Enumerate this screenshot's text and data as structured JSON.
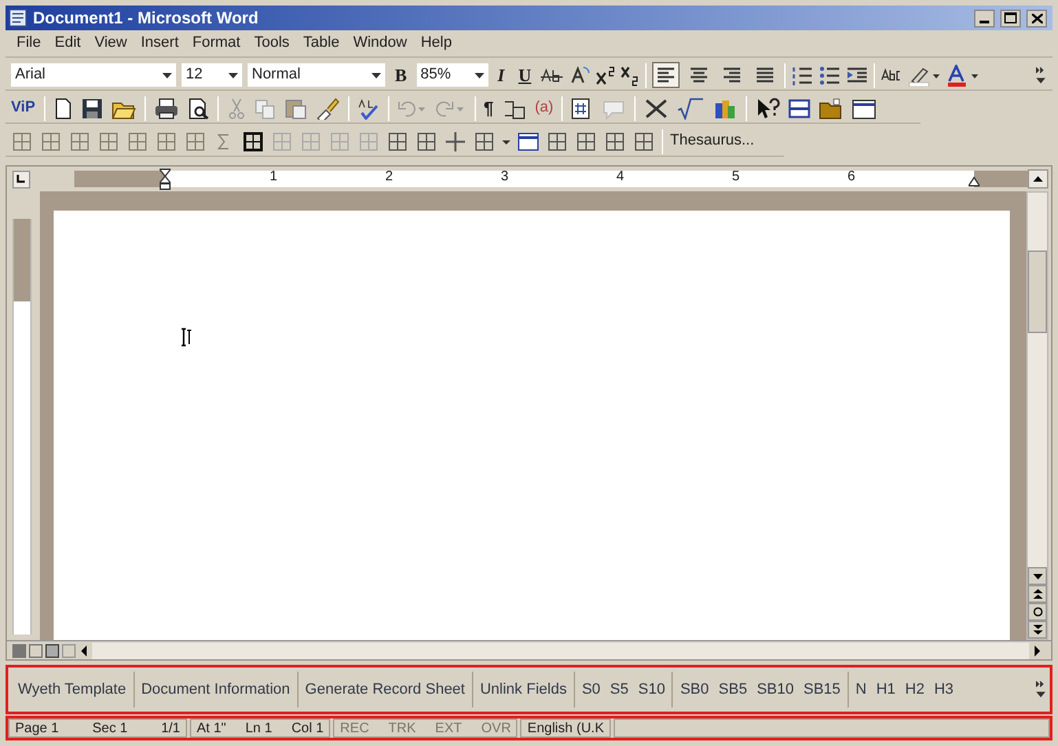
{
  "window": {
    "title": "Document1 - Microsoft Word"
  },
  "menu": [
    "File",
    "Edit",
    "View",
    "Insert",
    "Format",
    "Tools",
    "Table",
    "Window",
    "Help"
  ],
  "formatting": {
    "font": "Arial",
    "size": "12",
    "style": "Normal",
    "bold": "B",
    "zoom": "85%",
    "italic": "I",
    "underline": "U",
    "align": [
      {
        "selected": true
      },
      {
        "selected": false
      },
      {
        "selected": false
      },
      {
        "selected": false
      }
    ]
  },
  "standard": {
    "vip": "ViP",
    "pilcrow": "¶",
    "field": "(a)"
  },
  "tables_toolbar": {
    "thesaurus": "Thesaurus..."
  },
  "ruler": {
    "numbers": [
      "1",
      "2",
      "3",
      "4",
      "5",
      "6"
    ]
  },
  "custom_toolbar": {
    "groups": [
      [
        "Wyeth Template"
      ],
      [
        "Document Information"
      ],
      [
        "Generate Record Sheet"
      ],
      [
        "Unlink Fields"
      ],
      [
        "S0",
        "S5",
        "S10"
      ],
      [
        "SB0",
        "SB5",
        "SB10",
        "SB15"
      ],
      [
        "N",
        "H1",
        "H2",
        "H3"
      ]
    ]
  },
  "status_bar": [
    [
      {
        "text": "Page 1",
        "disabled": false
      },
      {
        "text": "Sec 1",
        "disabled": false
      },
      {
        "text": "1/1",
        "disabled": false
      }
    ],
    [
      {
        "text": "At 1\"",
        "disabled": false
      },
      {
        "text": "Ln 1",
        "disabled": false
      },
      {
        "text": "Col 1",
        "disabled": false
      }
    ],
    [
      {
        "text": "REC",
        "disabled": true
      },
      {
        "text": "TRK",
        "disabled": true
      },
      {
        "text": "EXT",
        "disabled": true
      },
      {
        "text": "OVR",
        "disabled": true
      }
    ],
    [
      {
        "text": "English (U.K",
        "disabled": false
      }
    ]
  ]
}
